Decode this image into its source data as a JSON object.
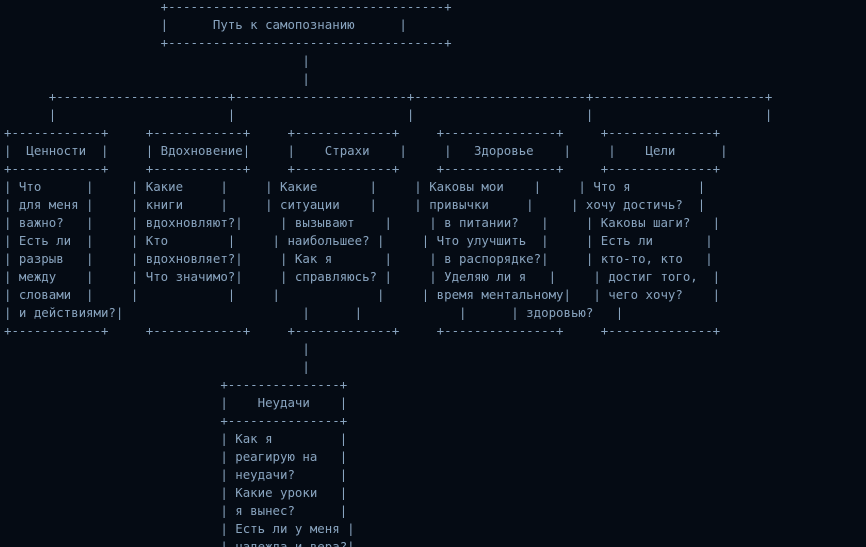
{
  "diagram": {
    "lines": [
      "                     +-------------------------------------+",
      "                     |      Путь к самопознанию      |",
      "                     +-------------------------------------+",
      "                                        |",
      "                                        |",
      "      +-----------------------+-----------------------+-----------------------+-----------------------+",
      "      |                       |                       |                       |                       |",
      "+------------+     +------------+     +-------------+     +---------------+     +--------------+",
      "|  Ценности  |     | Вдохновение|     |    Страхи    |     |   Здоровье    |     |    Цели      |",
      "+------------+     +------------+     +-------------+     +---------------+     +--------------+",
      "| Что      |     | Какие     |     | Какие       |     | Каковы мои    |     | Что я         |",
      "| для меня |     | книги     |     | ситуации    |     | привычки     |     | хочу достичь?  |",
      "| важно?   |     | вдохновляют?|     | вызывают    |     | в питании?   |     | Каковы шаги?   |",
      "| Есть ли  |     | Кто        |     | наибольшее? |     | Что улучшить  |     | Есть ли       |",
      "| разрыв   |     | вдохновляет?|     | Как я       |     | в распорядке?|     | кто-то, кто   |",
      "| между    |     | Что значимо?|     | справляюсь? |     | Уделяю ли я   |     | достиг того,  |",
      "| словами  |     |            |     |             |     | время ментальному|   | чего хочу?    |",
      "| и действиями?|                        |      |             |      | здоровью?   |",
      "+------------+     +------------+     +-------------+     +---------------+     +--------------+",
      "                                        |",
      "                                        |",
      "                             +---------------+",
      "                             |    Неудачи    |",
      "                             +---------------+",
      "                             | Как я         |",
      "                             | реагирую на   |",
      "                             | неудачи?      |",
      "                             | Какие уроки   |",
      "                             | я вынес?      |",
      "                             | Есть ли у меня |",
      "                             | надежда и вера?|"
    ]
  }
}
